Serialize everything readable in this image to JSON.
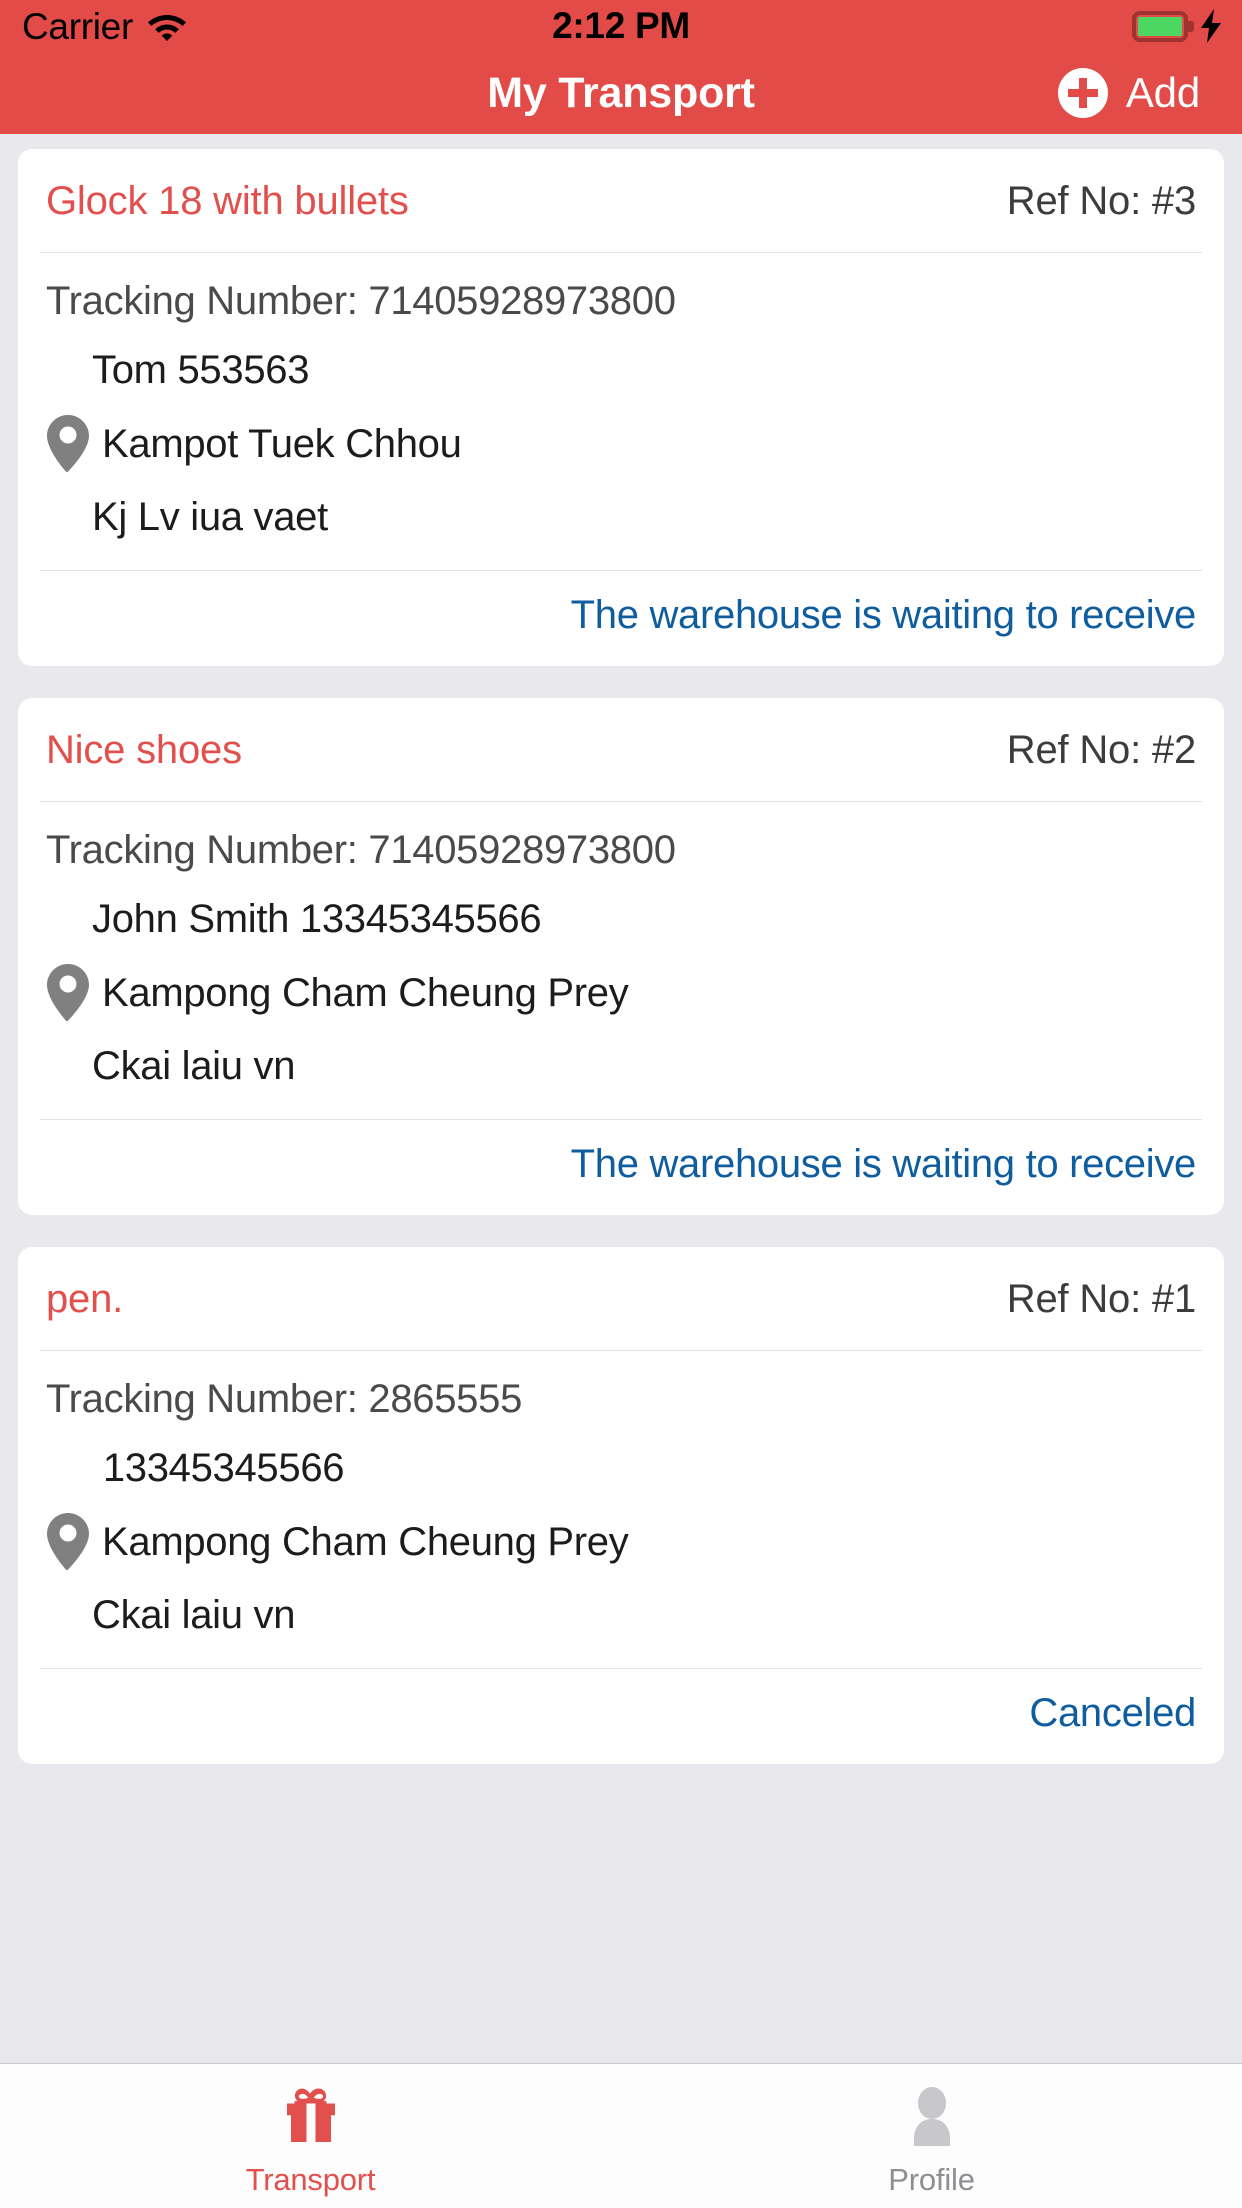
{
  "status_bar": {
    "carrier": "Carrier",
    "wifi_icon": "wifi-icon",
    "time": "2:12 PM",
    "battery_icon": "battery-icon",
    "charging_icon": "lightning-bolt-icon"
  },
  "nav_bar": {
    "title": "My Transport",
    "add_label": "Add",
    "add_icon": "plus-circle-icon",
    "background_color": "#E24B48"
  },
  "colors": {
    "accent_red": "#E2504E",
    "nav_red": "#E24B48",
    "status_link_blue": "#0F5C9E",
    "page_background": "#E8E8ED",
    "card_background": "#FFFFFF",
    "inactive_gray": "#8E8E93"
  },
  "labels": {
    "tracking_prefix": "Tracking Number: ",
    "ref_prefix": "Ref No: "
  },
  "shipments": [
    {
      "title": "Glock 18 with bullets",
      "ref": "Ref No: #3",
      "tracking": "Tracking Number: 71405928973800",
      "person": "Tom 553563",
      "location_icon": "map-pin-icon",
      "location": "Kampot Tuek Chhou",
      "note": "Kj Lv iua vaet",
      "status": "The warehouse is waiting to receive"
    },
    {
      "title": "Nice shoes",
      "ref": "Ref No: #2",
      "tracking": "Tracking Number: 71405928973800",
      "person": "John Smith 13345345566",
      "location_icon": "map-pin-icon",
      "location": "Kampong Cham Cheung Prey",
      "note": "Ckai laiu vn",
      "status": "The warehouse is waiting to receive"
    },
    {
      "title": "pen.",
      "ref": "Ref No: #1",
      "tracking": "Tracking Number: 2865555",
      "person": " 13345345566",
      "location_icon": "map-pin-icon",
      "location": "Kampong Cham Cheung Prey",
      "note": "Ckai laiu vn",
      "status": "Canceled"
    }
  ],
  "tab_bar": {
    "tabs": [
      {
        "label": "Transport",
        "icon": "gift-icon",
        "active": true
      },
      {
        "label": "Profile",
        "icon": "person-icon",
        "active": false
      }
    ]
  }
}
